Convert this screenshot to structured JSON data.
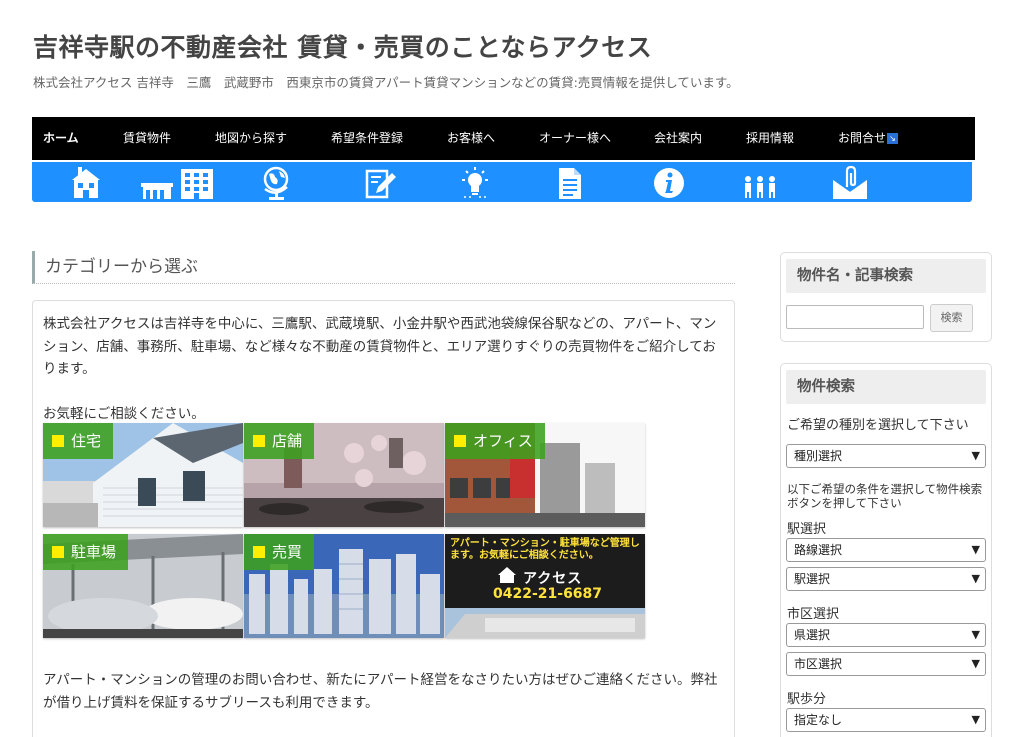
{
  "site": {
    "title": "吉祥寺駅の不動産会社 賃貸・売買のことならアクセス",
    "description": "株式会社アクセス 吉祥寺　三鷹　武蔵野市　西東京市の賃貸アパート賃貸マンションなどの賃貸:売買情報を提供しています。"
  },
  "nav": {
    "items": [
      {
        "label": "ホーム"
      },
      {
        "label": "賃貸物件"
      },
      {
        "label": "地図から探す"
      },
      {
        "label": "希望条件登録"
      },
      {
        "label": "お客様へ"
      },
      {
        "label": "オーナー様へ"
      },
      {
        "label": "会社案内"
      },
      {
        "label": "採用情報"
      },
      {
        "label": "お問合せ",
        "badge": "↘"
      }
    ],
    "icons": [
      "house-icon",
      "building-icon",
      "globe-icon",
      "edit-icon",
      "lightbulb-icon",
      "document-icon",
      "info-icon",
      "people-icon",
      "mail-icon"
    ],
    "bar_color": "#1e90ff"
  },
  "main": {
    "category_heading": "カテゴリーから選ぶ",
    "intro": "株式会社アクセスは吉祥寺を中心に、三鷹駅、武蔵境駅、小金井駅や西武池袋線保谷駅などの、アパート、マンション、店舗、事務所、駐車場、など様々な不動産の賃貸物件と、エリア選りすぐりの売買物件をご紹介しております。",
    "consult": "お気軽にご相談ください。",
    "tiles": [
      {
        "label": "住宅"
      },
      {
        "label": "店舗"
      },
      {
        "label": "オフィス"
      },
      {
        "label": "駐車場"
      },
      {
        "label": "売買"
      }
    ],
    "promo": {
      "text": "アパート・マンション・駐車場など管理します。お気軽にご相談ください。",
      "company": "アクセス",
      "phone": "0422-21-6687"
    },
    "bottom_text": "アパート・マンションの管理のお問い合わせ、新たにアパート経営をなさりたい方はぜひご連絡ください。弊社が借り上げ賃料を保証するサブリースも利用できます。"
  },
  "sidebar": {
    "search_widget": {
      "title": "物件名・記事検索",
      "input_value": "",
      "button": "検索"
    },
    "property_search": {
      "title": "物件検索",
      "type_prompt": "ご希望の種別を選択して下さい",
      "type_select": "種別選択",
      "condition_prompt": "以下ご希望の条件を選択して物件検索ボタンを押して下さい",
      "station_label": "駅選択",
      "line_select": "路線選択",
      "station_select": "駅選択",
      "city_label": "市区選択",
      "pref_select": "県選択",
      "city_select": "市区選択",
      "walk_label": "駅歩分",
      "walk_select": "指定なし"
    }
  }
}
